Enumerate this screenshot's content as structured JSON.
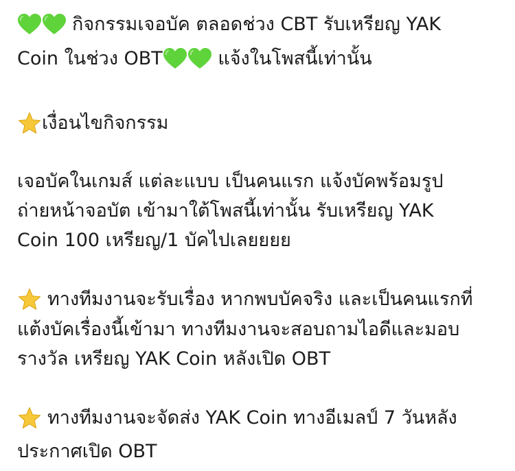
{
  "post": {
    "p1": {
      "l1_text": "กิจกรรมเจอบัค ตลอดช่วง CBT รับเหรียญ YAK",
      "l2_text": "Coin ในช่วง OBT",
      "l2_tail": " แจ้งในโพสนี้เท่านั้น"
    },
    "p2": {
      "l1_text": "เงื่อนไขกิจกรรม"
    },
    "p3": {
      "l1_text": "เจอบัคในเกมส์ แต่ละแบบ เป็นคนแรก แจ้งบัคพร้อมรูป",
      "l2_text": "ถ่ายหน้าจอบัต เข้ามาใต้โพสนี้เท่านั้น รับเหรียญ YAK",
      "l3_text": "Coin 100 เหรียญ/1 บัคไปเลยยยย"
    },
    "p4": {
      "l1_text": "ทางทีมงานจะรับเรื่อง หากพบบัคจริง และเป็นคนแรกที่",
      "l2_text": "แต้งบัคเรื่องนี้เข้ามา ทางทีมงานจะสอบถามไอดีและมอบ",
      "l3_text": "รางวัล เหรียญ YAK Coin หลังเปิด OBT"
    },
    "p5": {
      "l1_text": "ทางทีมงานจะจัดส่ง YAK Coin ทางอีเมลป์ 7 วันหลัง",
      "l2_text": "ประกาศเปิด OBT"
    }
  },
  "icons": {
    "heart": "green-heart-icon",
    "star": "star-icon"
  },
  "colors": {
    "text": "#1c1c1e",
    "heart": "#5fd33a",
    "star": "#f7c93a",
    "background": "#ffffff"
  }
}
